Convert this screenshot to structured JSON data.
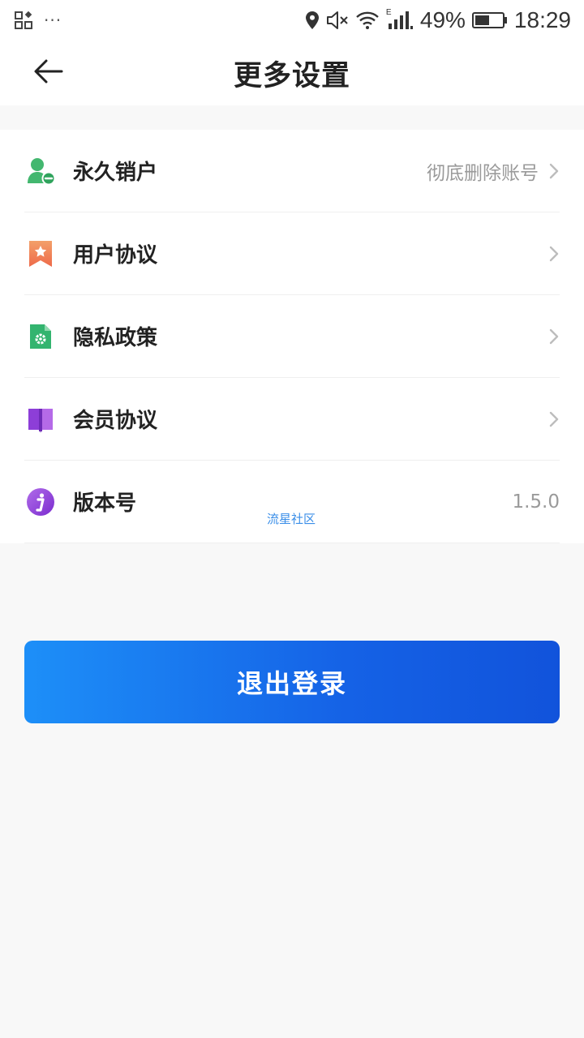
{
  "status_bar": {
    "dots": "···",
    "battery": "49%",
    "time": "18:29",
    "network_type": "E",
    "icons": [
      "app-grid-icon",
      "location-icon",
      "mute-icon",
      "wifi-icon",
      "signal-icon",
      "battery-icon"
    ]
  },
  "header": {
    "title": "更多设置",
    "back_icon": "arrow-left-icon"
  },
  "settings": [
    {
      "label": "永久销户",
      "value": "彻底删除账号",
      "icon": "user-remove-icon",
      "icon_color": "#3cb371",
      "chevron": true
    },
    {
      "label": "用户协议",
      "value": "",
      "icon": "star-bookmark-icon",
      "icon_color": "#f07a50",
      "chevron": true
    },
    {
      "label": "隐私政策",
      "value": "",
      "icon": "gear-document-icon",
      "icon_color": "#2fb36e",
      "chevron": true
    },
    {
      "label": "会员协议",
      "value": "",
      "icon": "book-icon",
      "icon_color": "#8b3fd9",
      "chevron": true
    },
    {
      "label": "版本号",
      "value": "1.5.0",
      "icon": "info-icon",
      "icon_color": "#8b3fd9",
      "chevron": false
    }
  ],
  "watermark": "流星社区",
  "logout": {
    "label": "退出登录",
    "gradient_start": "#1d8ff8",
    "gradient_end": "#1153db"
  }
}
